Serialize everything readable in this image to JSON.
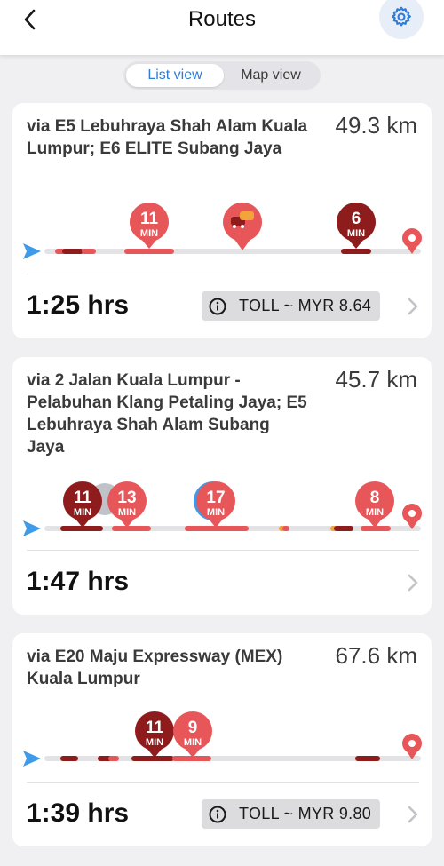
{
  "header": {
    "title": "Routes",
    "back_icon": "chevron-left-icon",
    "settings_icon": "gear-icon",
    "accent": "#2f7bd6"
  },
  "view_toggle": {
    "options": [
      {
        "label": "List view",
        "selected": true
      },
      {
        "label": "Map view",
        "selected": false
      }
    ]
  },
  "colors": {
    "heavy_traffic": "#8e1c1c",
    "moderate_traffic": "#e7575a",
    "light_traffic": "#f2a33a",
    "road": "#e3e3e6",
    "start_arrow": "#3d9be9",
    "destination": "#e7575a"
  },
  "routes": [
    {
      "via": "via E5 Lebuhraya Shah Alam Kuala Lumpur; E6 ELITE Subang Jaya",
      "distance": "49.3 km",
      "duration": "1:25 hrs",
      "toll": "TOLL ~ MYR 8.64",
      "delays": [
        {
          "minutes": "11",
          "unit": "MIN",
          "severity": "moderate"
        },
        {
          "type": "accident",
          "icon": "car-crash-icon"
        },
        {
          "minutes": "6",
          "unit": "MIN",
          "severity": "heavy"
        }
      ]
    },
    {
      "via": "via 2 Jalan Kuala Lumpur - Pelabuhan Klang Petaling Jaya; E5 Lebuhraya Shah Alam Subang Jaya",
      "distance": "45.7 km",
      "duration": "1:47 hrs",
      "toll": "",
      "delays": [
        {
          "minutes": "11",
          "unit": "MIN",
          "severity": "heavy"
        },
        {
          "minutes": "13",
          "unit": "MIN",
          "severity": "moderate"
        },
        {
          "minutes": "17",
          "unit": "MIN",
          "severity": "moderate"
        },
        {
          "minutes": "8",
          "unit": "MIN",
          "severity": "moderate"
        }
      ]
    },
    {
      "via": "via E20 Maju Expressway (MEX) Kuala Lumpur",
      "distance": "67.6 km",
      "duration": "1:39 hrs",
      "toll": "TOLL ~ MYR 9.80",
      "delays": [
        {
          "minutes": "11",
          "unit": "MIN",
          "severity": "heavy"
        },
        {
          "minutes": "9",
          "unit": "MIN",
          "severity": "moderate"
        }
      ]
    }
  ]
}
